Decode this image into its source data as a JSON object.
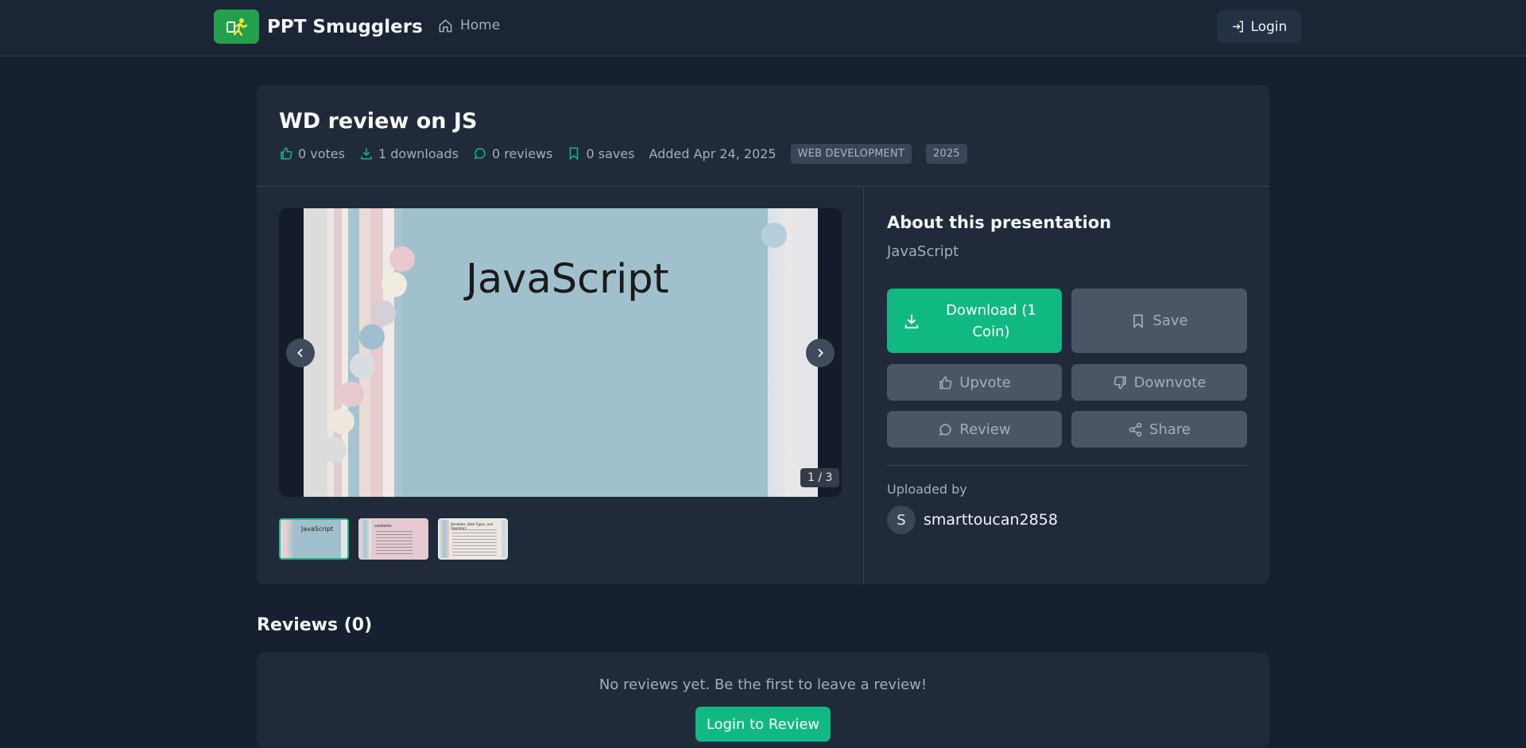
{
  "header": {
    "brand": "PPT Smugglers",
    "nav_home": "Home",
    "login": "Login"
  },
  "presentation": {
    "title": "WD review on JS",
    "votes": "0 votes",
    "downloads": "1 downloads",
    "reviews": "0 reviews",
    "saves": "0 saves",
    "added": "Added Apr 24, 2025",
    "tags": [
      "WEB DEVELOPMENT",
      "2025"
    ]
  },
  "viewer": {
    "slide_title": "JavaScript",
    "counter": "1 / 3",
    "current_slide": 1,
    "total_slides": 3,
    "thumbs": [
      {
        "label": "JavaScript"
      },
      {
        "label": "contents"
      },
      {
        "label": "Variables, Data Types, and Operators"
      }
    ]
  },
  "about": {
    "title": "About this presentation",
    "description": "JavaScript",
    "download_label": "Download (1 Coin)",
    "save_label": "Save",
    "upvote_label": "Upvote",
    "downvote_label": "Downvote",
    "review_label": "Review",
    "share_label": "Share",
    "uploaded_by_label": "Uploaded by",
    "uploader_initial": "S",
    "uploader_name": "smarttoucan2858"
  },
  "reviews_section": {
    "title": "Reviews (0)",
    "empty_text": "No reviews yet. Be the first to leave a review!",
    "login_to_review": "Login to Review"
  },
  "colors": {
    "accent": "#10b981",
    "brand_logo": "#22a04b",
    "background": "#172031",
    "card": "#202a3b"
  },
  "icons": [
    "brand-logo-icon",
    "home-icon",
    "login-icon",
    "thumbs-up-icon",
    "download-icon",
    "comment-icon",
    "bookmark-icon",
    "chevron-left-icon",
    "chevron-right-icon",
    "thumbs-down-icon",
    "share-icon"
  ]
}
